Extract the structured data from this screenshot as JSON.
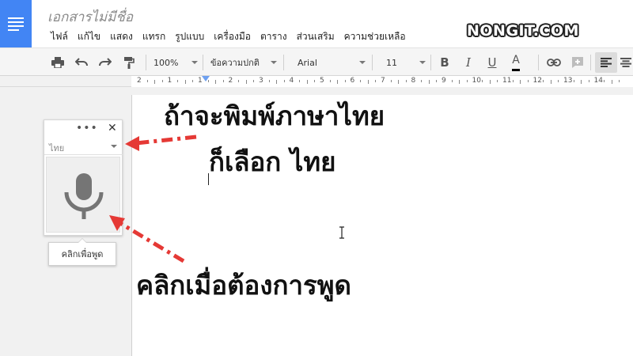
{
  "header": {
    "title": "เอกสารไม่มีชื่อ",
    "menu": [
      "ไฟล์",
      "แก้ไข",
      "แสดง",
      "แทรก",
      "รูปแบบ",
      "เครื่องมือ",
      "ตาราง",
      "ส่วนเสริม",
      "ความช่วยเหลือ"
    ],
    "watermark": "NONGIT.COM"
  },
  "toolbar": {
    "zoom": "100%",
    "style": "ข้อความปกติ",
    "font": "Arial",
    "size": "11",
    "bold": "B",
    "italic": "I",
    "underline": "U",
    "text_color": "A"
  },
  "ruler": {
    "labels": [
      "2",
      "1",
      "1",
      "2",
      "3",
      "4",
      "5",
      "6",
      "7",
      "8",
      "9",
      "10",
      "11",
      "12",
      "13",
      "14"
    ]
  },
  "voice_typing": {
    "dots": "•••",
    "close": "✕",
    "language": "ไทย",
    "tooltip": "คลิกเพื่อพูด"
  },
  "annotations": {
    "line1": "ถ้าจะพิมพ์ภาษาไทย",
    "line2": "ก็เลือก ไทย",
    "line3": "คลิกเมื่อต้องการพูด"
  },
  "colors": {
    "docs_blue": "#4285f4",
    "arrow_red": "#e53935",
    "mic_gray": "#757575"
  }
}
